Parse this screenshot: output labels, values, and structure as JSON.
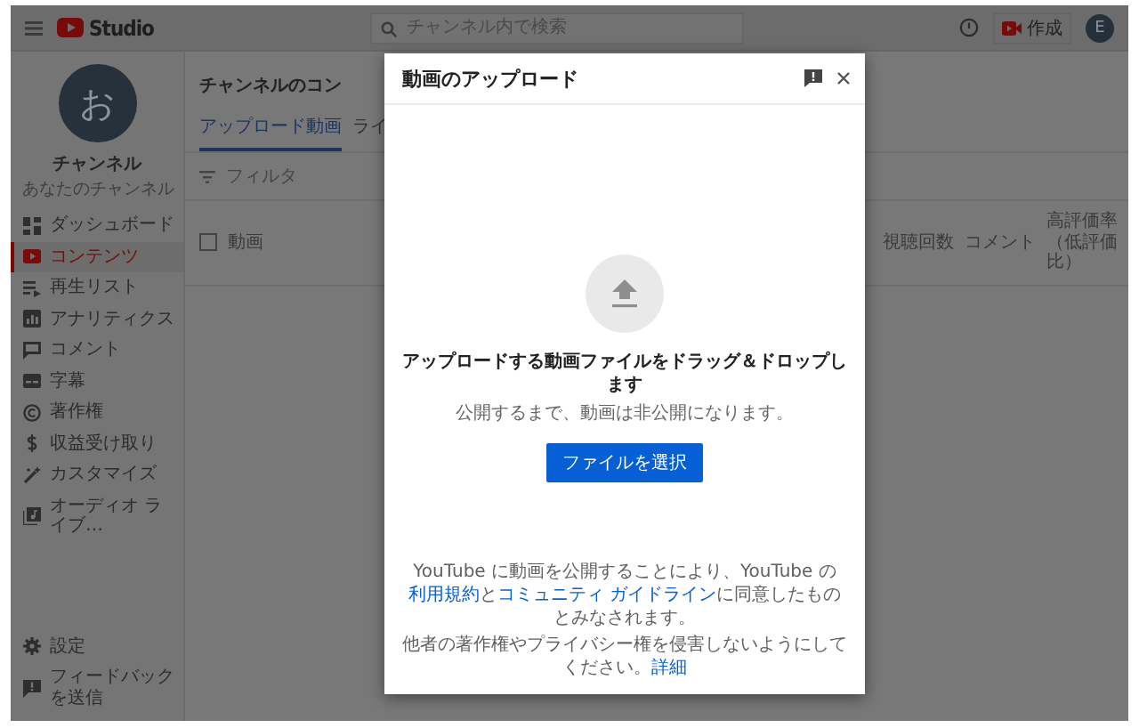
{
  "header": {
    "logo": "Studio",
    "search": {
      "placeholder": "チャンネル内で検索"
    },
    "create_button": "作成",
    "avatar": "E"
  },
  "channel": {
    "avatar": "お",
    "name": "チャンネル",
    "subtitle": "あなたのチャンネル"
  },
  "sidebar": {
    "items": [
      {
        "label": "ダッシュボード",
        "selected": false
      },
      {
        "label": "コンテンツ",
        "selected": true
      },
      {
        "label": "再生リスト",
        "selected": false
      },
      {
        "label": "アナリティクス",
        "selected": false
      },
      {
        "label": "コメント",
        "selected": false
      },
      {
        "label": "字幕",
        "selected": false
      },
      {
        "label": "著作権",
        "selected": false
      },
      {
        "label": "収益受け取り",
        "selected": false
      },
      {
        "label": "カスタマイズ",
        "selected": false
      },
      {
        "label": "オーディオ ライブ…",
        "selected": false
      }
    ],
    "footer_items": [
      {
        "label": "設定"
      },
      {
        "label": "フィードバックを送信"
      }
    ]
  },
  "content": {
    "title": "チャンネルのコン",
    "tabs": [
      {
        "label": "アップロード動画",
        "selected": true
      },
      {
        "label": "ライ",
        "selected": false
      }
    ],
    "filter": "フィルタ",
    "select_all": {
      "checked": false
    },
    "columns": [
      "動画",
      "視聴回数",
      "コメント",
      "高評価率（低評価比）"
    ]
  },
  "dialog": {
    "title": "動画のアップロード",
    "heading": "アップロードする動画ファイルをドラッグ＆ドロップします",
    "note": "公開するまで、動画は非公開になります。",
    "button": "ファイルを選択",
    "footer": [
      [
        {
          "kind": "text",
          "text": "YouTube に動画を公開することにより、YouTube の"
        },
        {
          "kind": "link",
          "text": "利用規約"
        },
        {
          "kind": "text",
          "text": "と"
        },
        {
          "kind": "link",
          "text": "コミュニティ ガイドライン"
        },
        {
          "kind": "text",
          "text": "に同意したものとみなされます。"
        }
      ],
      [
        {
          "kind": "text",
          "text": "他者の著作権やプライバシー権を侵害しないようにしてください。"
        },
        {
          "kind": "link",
          "text": "詳細"
        }
      ]
    ]
  }
}
